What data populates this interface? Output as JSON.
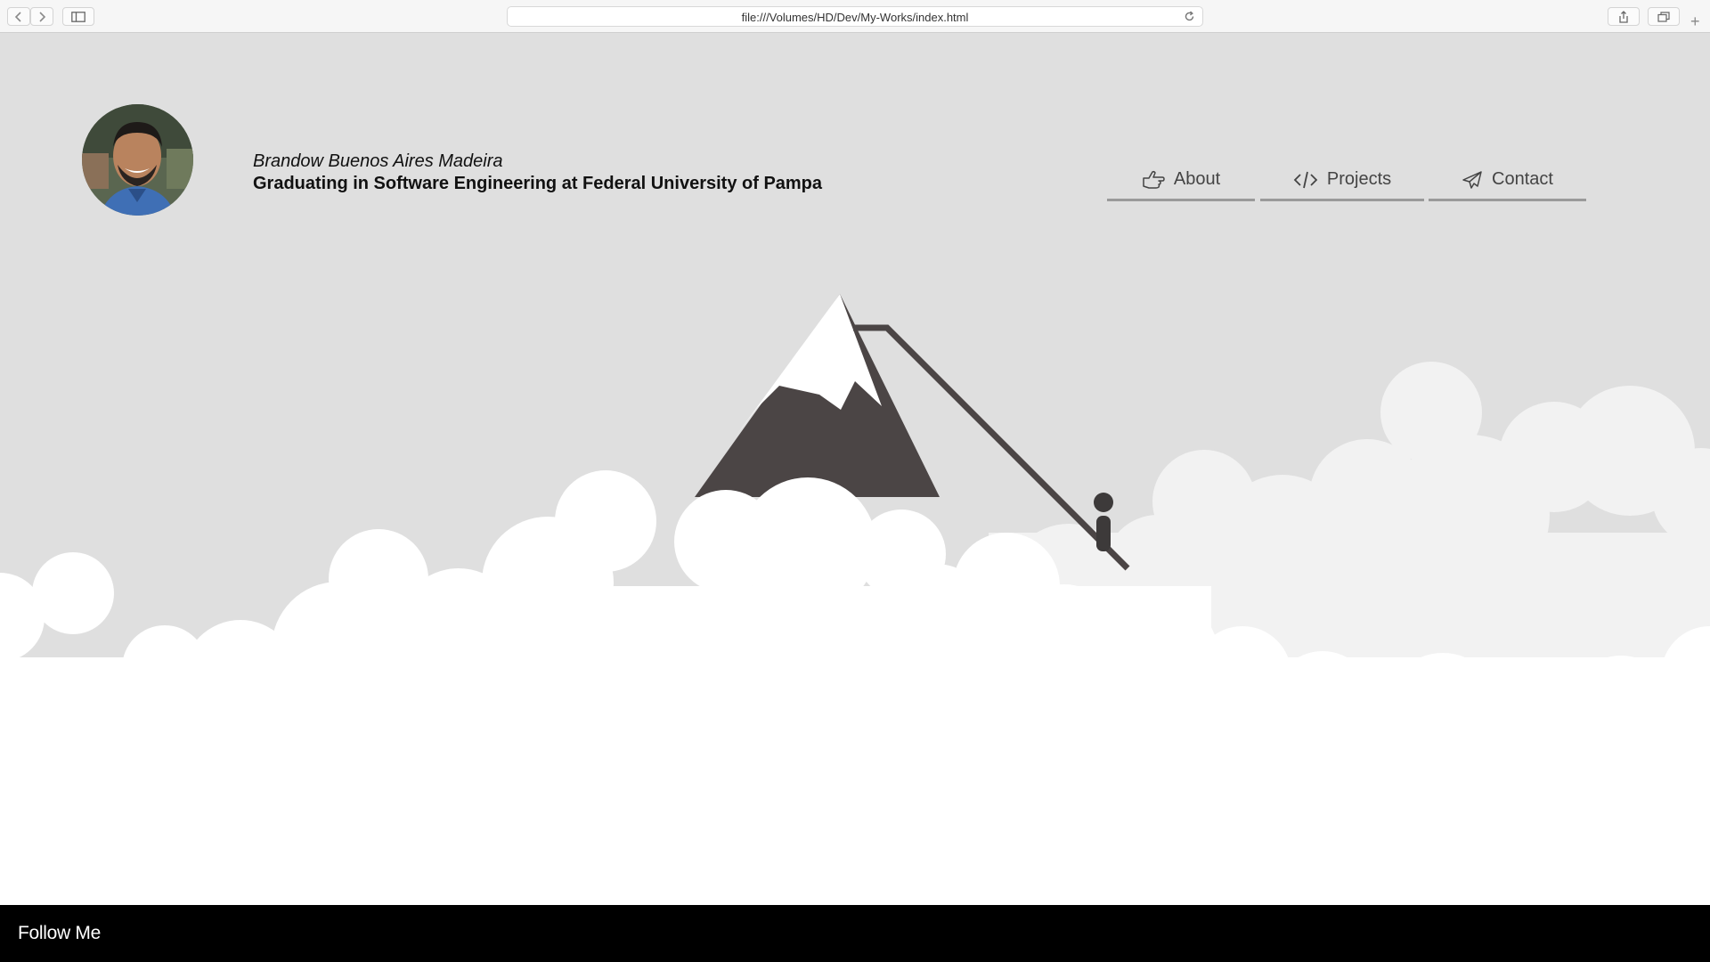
{
  "browser": {
    "url": "file:///Volumes/HD/Dev/My-Works/index.html",
    "icons": [
      "back-icon",
      "forward-icon",
      "sidebar-icon",
      "reload-icon",
      "share-icon",
      "tabs-icon",
      "new-tab-icon"
    ]
  },
  "header": {
    "name": "Brandow Buenos Aires Madeira",
    "subtitle": "Graduating in Software Engineering at Federal University of Pampa"
  },
  "nav": {
    "items": [
      {
        "label": "About",
        "icon": "hand-point-icon"
      },
      {
        "label": "Projects",
        "icon": "code-icon"
      },
      {
        "label": "Contact",
        "icon": "paper-plane-icon"
      }
    ]
  },
  "footer": {
    "label": "Follow Me"
  },
  "colors": {
    "background": "#dfdfdf",
    "mountain": "#4b4545",
    "snow": "#ffffff",
    "cloud_back": "#f2f2f2",
    "cloud_front": "#ffffff",
    "footer": "#000000",
    "nav_underline": "#9a9a9a"
  }
}
